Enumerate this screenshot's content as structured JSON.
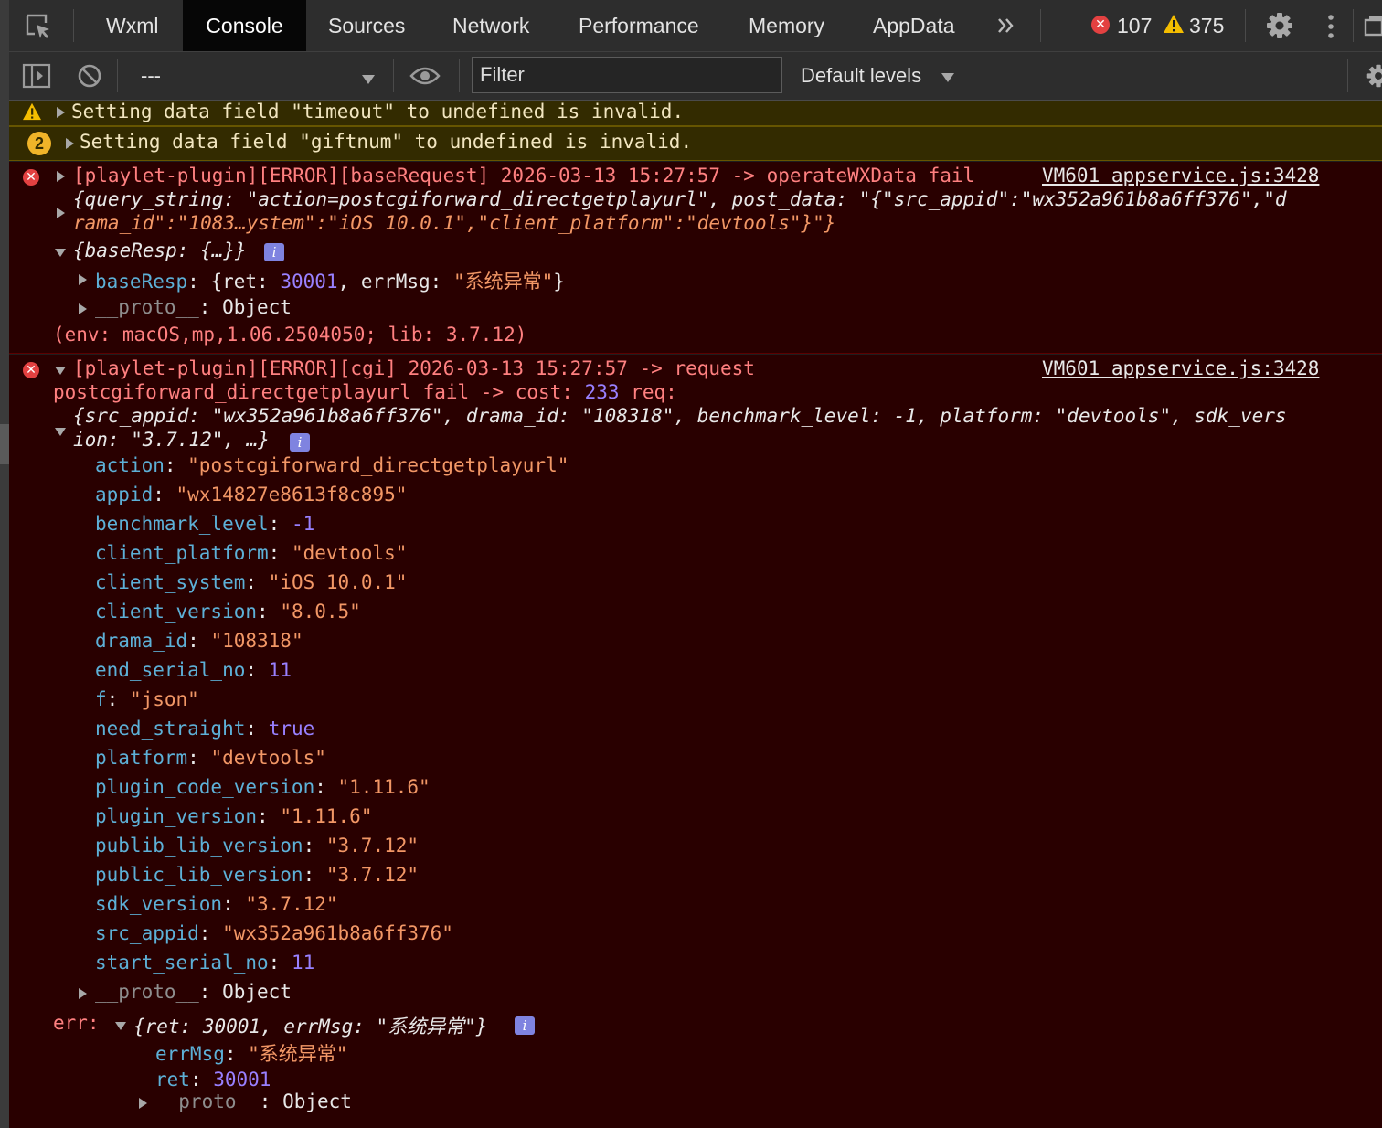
{
  "tabs": [
    "Wxml",
    "Console",
    "Sources",
    "Network",
    "Performance",
    "Memory",
    "AppData"
  ],
  "counts": {
    "errors": "107",
    "warnings": "375"
  },
  "toolbar": {
    "context": "---",
    "filter_placeholder": "Filter",
    "levels": "Default levels"
  },
  "colors": {
    "error_bg": "#290000",
    "warning_bg": "#332b00",
    "accent_key": "#5db0d7",
    "accent_string": "#f29766",
    "accent_number": "#9980ff"
  },
  "messages": {
    "warn1": "Setting data field \"timeout\" to undefined is invalid.",
    "warn2_count": "2",
    "warn2": "Setting data field \"giftnum\" to undefined is invalid.",
    "e1": {
      "head": "[playlet-plugin][ERROR][baseRequest] 2026-03-13 15:27:57 -> operateWXData fail",
      "source": "VM601 appservice.js:3428",
      "obj_l1": "{query_string: \"action=postcgiforward_directgetplayurl\", post_data: \"{\"src_appid\":\"wx352a961b8a6ff376\",\"d",
      "obj_l2": "rama_id\":\"1083…ystem\":\"iOS 10.0.1\",\"client_platform\":\"devtools\"}\"}",
      "obj2": "{baseResp: {…}}",
      "baseResp_key": "baseResp",
      "baseResp_pre": "{ret: ",
      "baseResp_ret": "30001",
      "baseResp_mid": ", errMsg: ",
      "baseResp_msg": "\"系统异常\"",
      "baseResp_end": "}",
      "proto_key": "__proto__",
      "proto_val": "Object",
      "env": "(env: macOS,mp,1.06.2504050; lib: 3.7.12)"
    },
    "e2": {
      "head": "[playlet-plugin][ERROR][cgi] 2026-03-13 15:27:57 -> request",
      "source": "VM601 appservice.js:3428",
      "line2_pre": "postcgiforward_directgetplayurl fail -> cost: ",
      "cost": "233",
      "line2_post": " req:",
      "req_l1": "{src_appid: \"wx352a961b8a6ff376\", drama_id: \"108318\", benchmark_level: -1, platform: \"devtools\", sdk_vers",
      "req_l2": "ion: \"3.7.12\", …}",
      "props": [
        {
          "k": "action",
          "v": "\"postcgiforward_directgetplayurl\""
        },
        {
          "k": "appid",
          "v": "\"wx14827e8613f8c895\""
        },
        {
          "k": "benchmark_level",
          "v": "-1"
        },
        {
          "k": "client_platform",
          "v": "\"devtools\""
        },
        {
          "k": "client_system",
          "v": "\"iOS 10.0.1\""
        },
        {
          "k": "client_version",
          "v": "\"8.0.5\""
        },
        {
          "k": "drama_id",
          "v": "\"108318\""
        },
        {
          "k": "end_serial_no",
          "v": "11"
        },
        {
          "k": "f",
          "v": "\"json\""
        },
        {
          "k": "need_straight",
          "v": "true"
        },
        {
          "k": "platform",
          "v": "\"devtools\""
        },
        {
          "k": "plugin_code_version",
          "v": "\"1.11.6\""
        },
        {
          "k": "plugin_version",
          "v": "\"1.11.6\""
        },
        {
          "k": "publib_lib_version",
          "v": "\"3.7.12\""
        },
        {
          "k": "public_lib_version",
          "v": "\"3.7.12\""
        },
        {
          "k": "sdk_version",
          "v": "\"3.7.12\""
        },
        {
          "k": "src_appid",
          "v": "\"wx352a961b8a6ff376\""
        },
        {
          "k": "start_serial_no",
          "v": "11"
        }
      ],
      "proto_key": "__proto__",
      "proto_val": "Object",
      "err_label": "err:",
      "err_obj": "{ret: 30001, errMsg: \"系统异常\"}",
      "err_props": [
        {
          "k": "errMsg",
          "v": "\"系统异常\""
        },
        {
          "k": "ret",
          "v": "30001"
        }
      ]
    }
  }
}
